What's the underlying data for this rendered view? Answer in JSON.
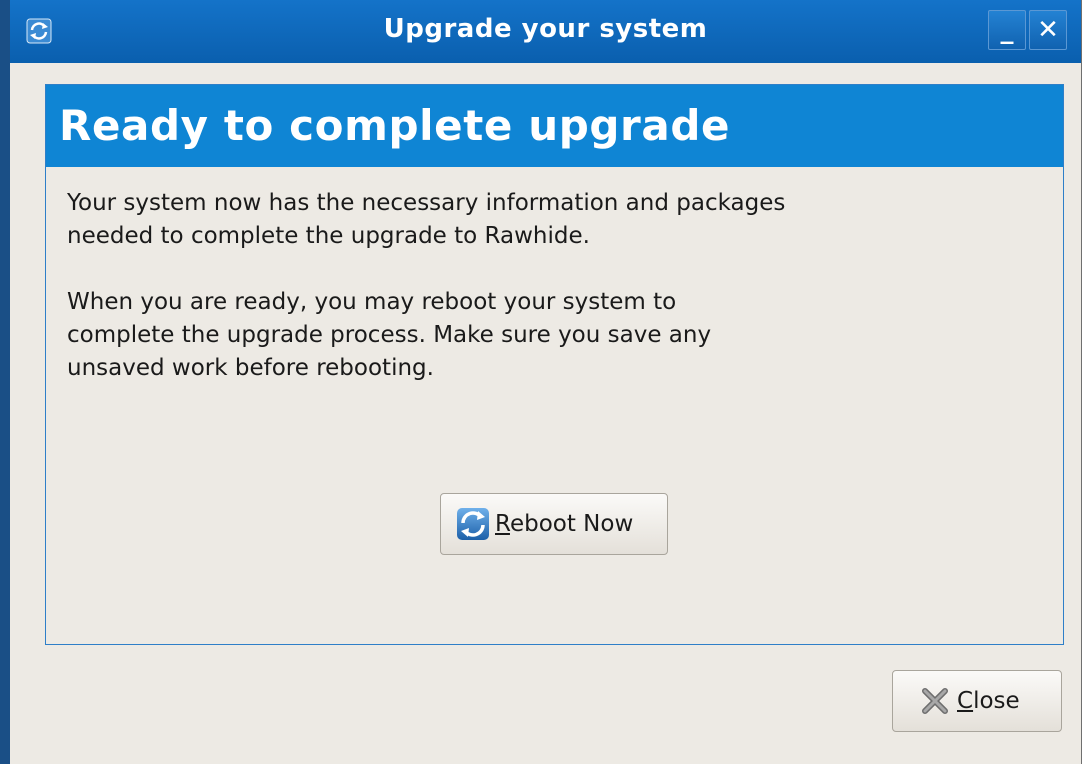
{
  "window": {
    "title": "Upgrade your system",
    "minimize_label": "_",
    "close_label": "✕"
  },
  "panel": {
    "heading": "Ready to complete upgrade",
    "paragraph1": "Your system now has the necessary information and packages\nneeded to complete the upgrade to Rawhide.",
    "paragraph2": "When you are ready, you may reboot your system to\ncomplete the upgrade process. Make sure you save any\nunsaved work before rebooting."
  },
  "buttons": {
    "reboot_mnemonic": "R",
    "reboot_rest": "eboot Now",
    "close_mnemonic": "C",
    "close_rest": "lose"
  },
  "colors": {
    "titlebar": "#0a5fae",
    "header": "#0f85d4",
    "background": "#edeae4"
  },
  "icons": {
    "app": "refresh-icon",
    "reboot": "refresh-icon",
    "close": "close-x-icon"
  }
}
